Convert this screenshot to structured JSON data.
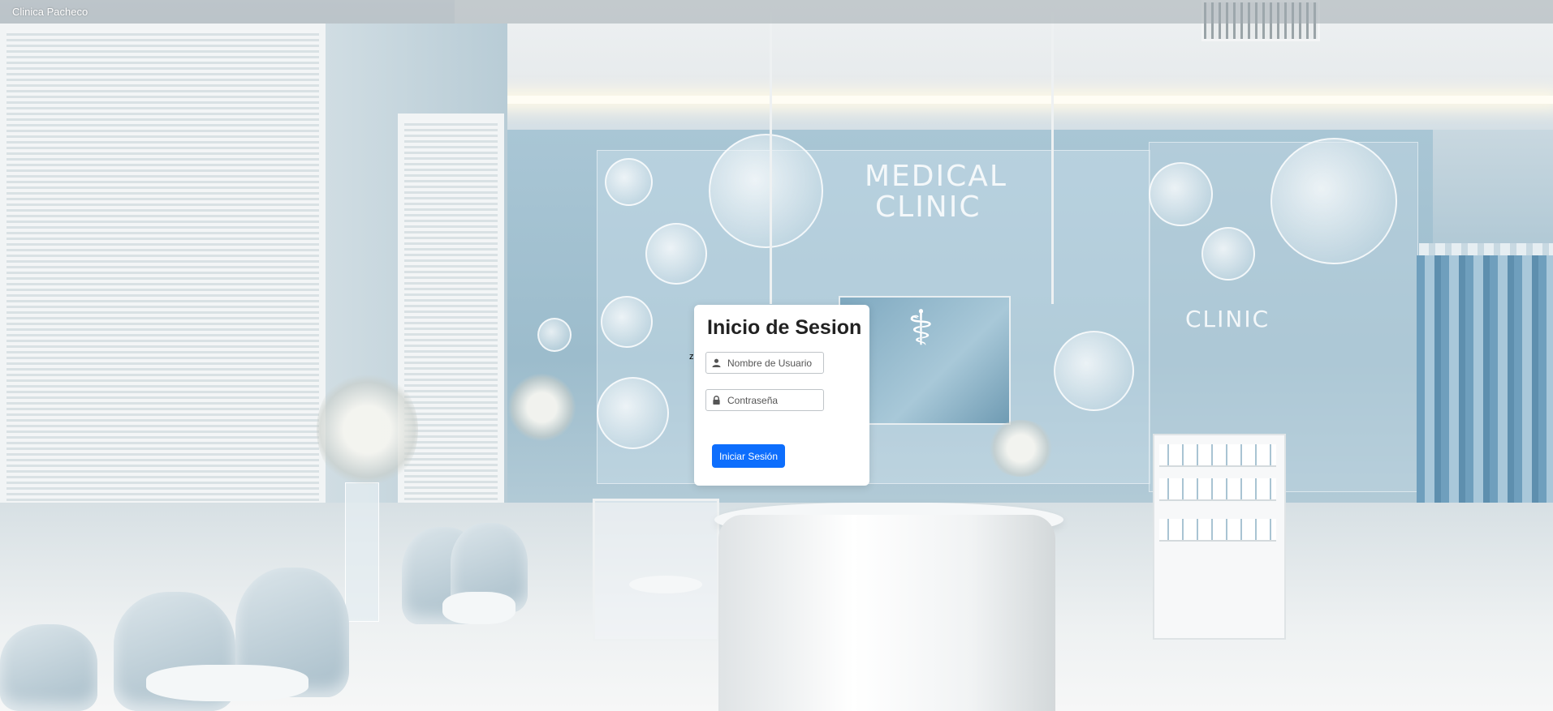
{
  "header": {
    "brand": "Clinica Pacheco"
  },
  "background": {
    "wall_sign_line1": "MEDICAL",
    "wall_sign_line2": "CLINIC",
    "wall_sign_right": "CLINIC"
  },
  "login": {
    "title": "Inicio de Sesion",
    "username_placeholder": "Nombre de Usuario",
    "username_value": "",
    "password_placeholder": "Contraseña",
    "password_value": "",
    "submit_label": "Iniciar Sesión",
    "user_icon": "user-icon",
    "lock_icon": "lock-icon"
  },
  "stray_char": "z",
  "colors": {
    "primary_button": "#0d6efd",
    "topbar": "#a0aaaf"
  }
}
